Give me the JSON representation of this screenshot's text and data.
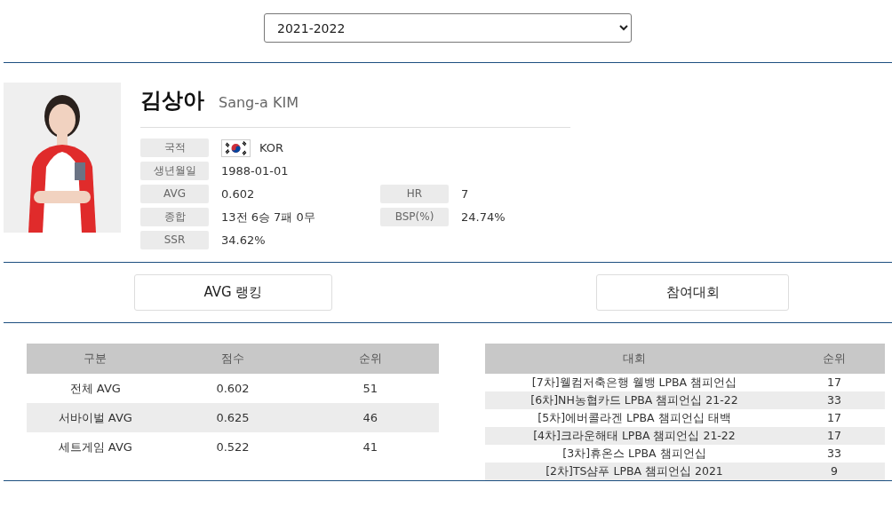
{
  "season_select": {
    "value": "2021-2022"
  },
  "player": {
    "name_ko": "김상아",
    "name_en": "Sang-a KIM",
    "info": [
      {
        "label": "국적",
        "value": "KOR",
        "kind": "flag"
      },
      {
        "label": "생년월일",
        "value": "1988-01-01",
        "kind": "text"
      },
      {
        "label": "AVG",
        "value": "0.602",
        "kind": "text",
        "label_2": "HR",
        "value_2": "7"
      },
      {
        "label": "종합",
        "value": "13전 6승 7패 0무",
        "kind": "text",
        "label_2": "BSP(%)",
        "value_2": "24.74%"
      },
      {
        "label": "SSR",
        "value": "34.62%",
        "kind": "text"
      }
    ]
  },
  "buttons": [
    "AVG 랭킹",
    "참여대회"
  ],
  "avg_table": {
    "columns": [
      "구분",
      "점수",
      "순위"
    ],
    "rows": [
      [
        "전체 AVG",
        "0.602",
        "51"
      ],
      [
        "서바이벌 AVG",
        "0.625",
        "46"
      ],
      [
        "세트게임 AVG",
        "0.522",
        "41"
      ]
    ]
  },
  "tournament_table": {
    "columns": [
      "대회",
      "순위"
    ],
    "rows": [
      [
        "[7차]웰컴저축은행 웰뱅 LPBA 챔피언십",
        "17"
      ],
      [
        "[6차]NH농협카드 LPBA 챔피언십 21-22",
        "33"
      ],
      [
        "[5차]에버콜라겐 LPBA 챔피언십 태백",
        "17"
      ],
      [
        "[4차]크라운해태 LPBA 챔피언십 21-22",
        "17"
      ],
      [
        "[3차]휴온스 LPBA 챔피언십",
        "33"
      ],
      [
        "[2차]TS샴푸 LPBA 챔피언십 2021",
        "9"
      ]
    ]
  }
}
